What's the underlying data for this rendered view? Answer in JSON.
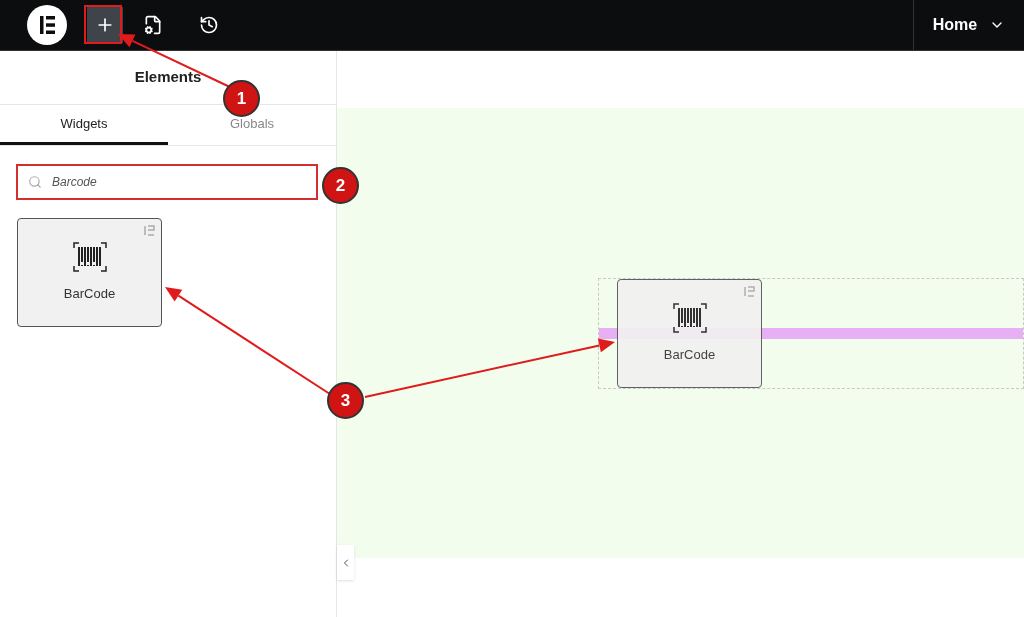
{
  "topbar": {
    "page_menu": {
      "label": "Home"
    }
  },
  "panel": {
    "title": "Elements",
    "tabs": [
      {
        "label": "Widgets",
        "selected": true
      },
      {
        "label": "Globals",
        "selected": false
      }
    ],
    "search": {
      "value": "Barcode"
    },
    "widgets": [
      {
        "label": "BarCode"
      }
    ]
  },
  "canvas": {
    "dropped_widget": {
      "label": "BarCode"
    }
  },
  "annotations": [
    {
      "number": "1"
    },
    {
      "number": "2"
    },
    {
      "number": "3"
    }
  ]
}
